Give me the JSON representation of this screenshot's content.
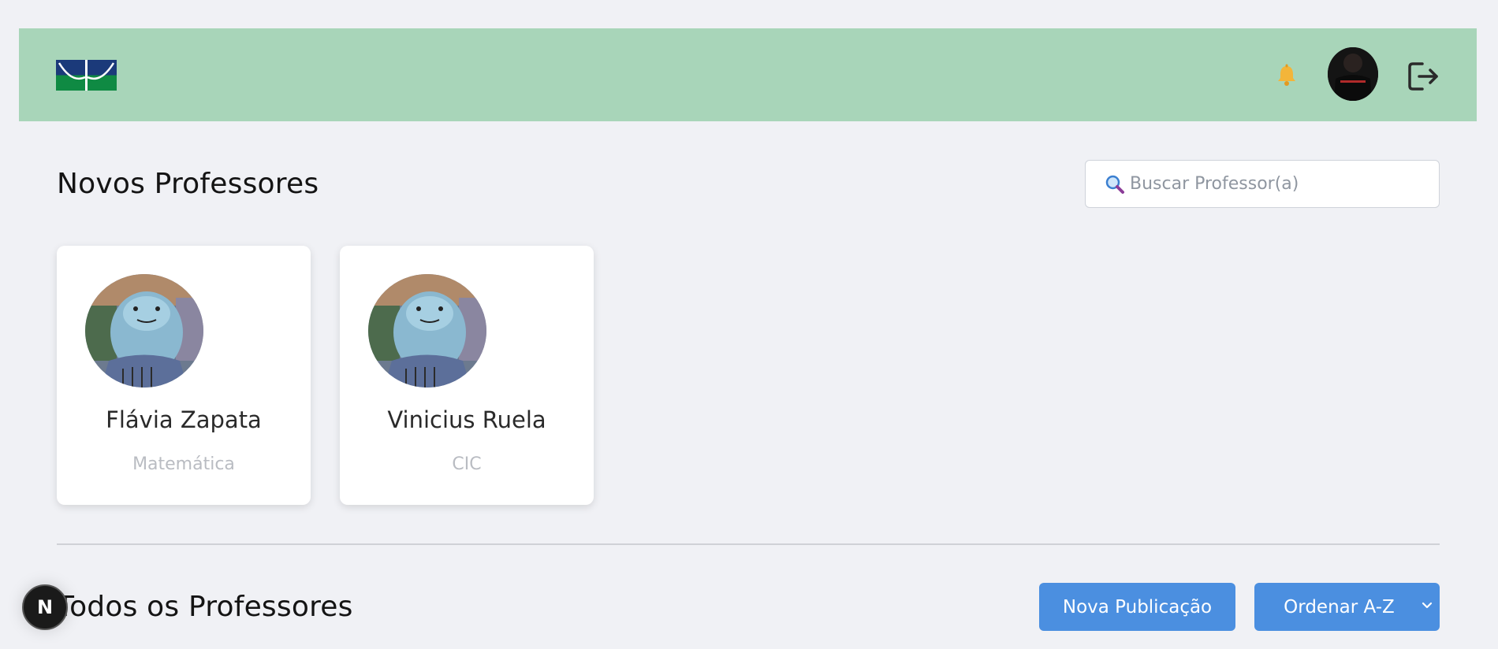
{
  "header": {
    "logo": "unb-logo",
    "notification_icon": "bell-icon",
    "avatar": "user-avatar",
    "logout_icon": "logout-icon",
    "accent_color": "#a8d5b9"
  },
  "new_section": {
    "title": "Novos Professores",
    "search_placeholder": "Buscar Professor(a)"
  },
  "professors": [
    {
      "name": "Flávia Zapata",
      "department": "Matemática"
    },
    {
      "name": "Vinicius Ruela",
      "department": "CIC"
    }
  ],
  "all_section": {
    "title": "Todos os Professores",
    "new_post_label": "Nova Publicação",
    "sort_label": "Ordenar A-Z",
    "button_color": "#4b8fe0"
  },
  "dev_badge": {
    "label": "N"
  }
}
